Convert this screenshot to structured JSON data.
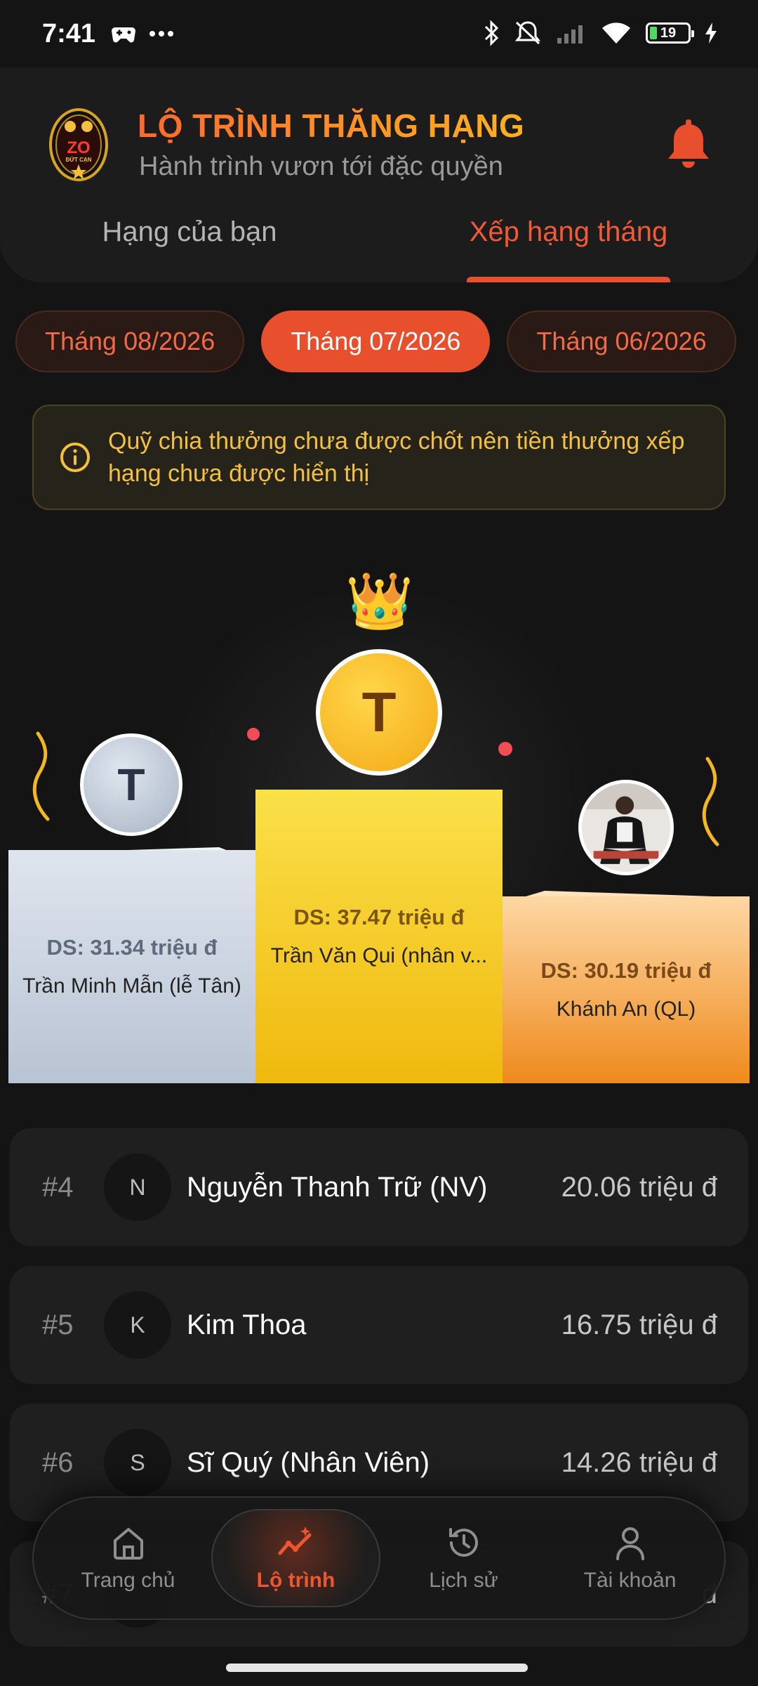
{
  "status_bar": {
    "time": "7:41",
    "battery": "19",
    "battery_level": 0.19
  },
  "header": {
    "title": "LỘ TRÌNH THĂNG HẠNG",
    "subtitle": "Hành trình vươn tới đặc quyền",
    "logo_text": "ZO",
    "logo_subtext": "ĐỨT CẠN"
  },
  "tabs": [
    {
      "label": "Hạng của bạn",
      "active": false
    },
    {
      "label": "Xếp hạng tháng",
      "active": true
    }
  ],
  "months": [
    {
      "label": "Tháng 08/2026",
      "active": false
    },
    {
      "label": "Tháng 07/2026",
      "active": true
    },
    {
      "label": "Tháng 06/2026",
      "active": false
    }
  ],
  "notice": {
    "text": "Quỹ chia thưởng chưa được chốt nên tiền thưởng xếp hạng chưa được hiển thị"
  },
  "podium": {
    "first": {
      "initial": "T",
      "sales": "DS: 37.47 triệu đ",
      "name": "Trần Văn Qui (nhân v..."
    },
    "second": {
      "initial": "T",
      "sales": "DS: 31.34 triệu đ",
      "name": "Trần Minh Mẫn (lễ Tân)"
    },
    "third": {
      "sales": "DS: 30.19 triệu đ",
      "name": "Khánh An (QL)"
    }
  },
  "ranking": [
    {
      "rank": "#4",
      "initial": "N",
      "name": "Nguyễn Thanh Trữ (NV)",
      "value": "20.06 triệu đ"
    },
    {
      "rank": "#5",
      "initial": "K",
      "name": "Kim Thoa",
      "value": "16.75 triệu đ"
    },
    {
      "rank": "#6",
      "initial": "S",
      "name": "Sĩ Quý (Nhân Viên)",
      "value": "14.26 triệu đ"
    },
    {
      "rank": "#7",
      "initial": "",
      "name": "",
      "value": "đ"
    }
  ],
  "bottom_nav": [
    {
      "label": "Trang chủ",
      "icon": "home-icon",
      "active": false
    },
    {
      "label": "Lộ trình",
      "icon": "route-icon",
      "active": true
    },
    {
      "label": "Lịch sử",
      "icon": "history-icon",
      "active": false
    },
    {
      "label": "Tài khoản",
      "icon": "account-icon",
      "active": false
    }
  ],
  "colors": {
    "accent": "#e8502d",
    "gold": "#f4c21e",
    "notice_text": "#f3c13e",
    "background": "#141414"
  }
}
